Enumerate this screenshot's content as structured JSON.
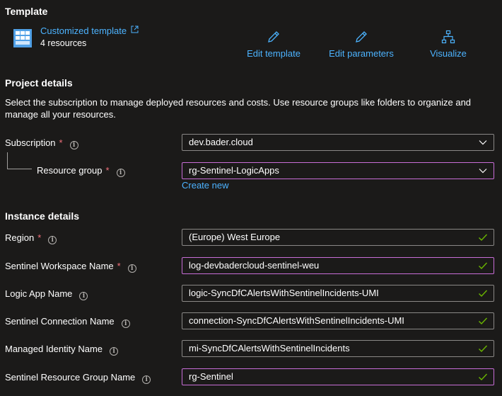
{
  "template": {
    "heading": "Template",
    "name": "Customized template",
    "resources": "4 resources",
    "actions": {
      "edit_template": "Edit template",
      "edit_parameters": "Edit parameters",
      "visualize": "Visualize"
    }
  },
  "project": {
    "heading": "Project details",
    "description": "Select the subscription to manage deployed resources and costs. Use resource groups like folders to organize and manage all your resources.",
    "subscription": {
      "label": "Subscription",
      "value": "dev.bader.cloud"
    },
    "resource_group": {
      "label": "Resource group",
      "value": "rg-Sentinel-LogicApps",
      "create_new": "Create new"
    }
  },
  "instance": {
    "heading": "Instance details",
    "fields": [
      {
        "label": "Region",
        "value": "(Europe) West Europe",
        "required": true
      },
      {
        "label": "Sentinel Workspace Name",
        "value": "log-devbadercloud-sentinel-weu",
        "required": true
      },
      {
        "label": "Logic App Name",
        "value": "logic-SyncDfCAlertsWithSentinelIncidents-UMI",
        "required": false
      },
      {
        "label": "Sentinel Connection Name",
        "value": "connection-SyncDfCAlertsWithSentinelIncidents-UMI",
        "required": false
      },
      {
        "label": "Managed Identity Name",
        "value": "mi-SyncDfCAlertsWithSentinelIncidents",
        "required": false
      },
      {
        "label": "Sentinel Resource Group Name",
        "value": "rg-Sentinel",
        "required": false
      }
    ]
  },
  "colors": {
    "link": "#4cb3ff",
    "required": "#f1707b",
    "valid": "#6bb700",
    "focus": "#c86dd7",
    "background": "#1b1a19"
  }
}
